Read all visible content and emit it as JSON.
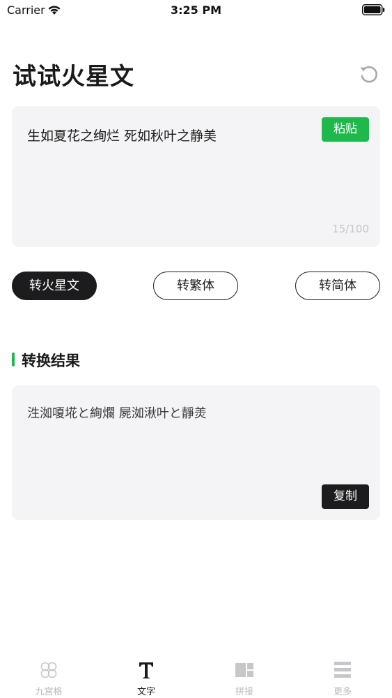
{
  "status_bar": {
    "carrier": "Carrier",
    "time": "3:25 PM"
  },
  "header": {
    "title": "试试火星文",
    "reset_icon": "refresh-icon"
  },
  "input": {
    "text": "生如夏花之绚烂 死如秋叶之静美",
    "paste_label": "粘贴",
    "char_count": "15/100"
  },
  "conversion": {
    "buttons": [
      {
        "label": "转火星文",
        "active": true
      },
      {
        "label": "转繁体",
        "active": false
      },
      {
        "label": "转简体",
        "active": false
      }
    ]
  },
  "result": {
    "title": "转换结果",
    "text": "泩洳嗄埖と絢爛 屍洳湫叶と靜羙",
    "copy_label": "复制"
  },
  "tab_bar": {
    "tabs": [
      {
        "label": "九宫格",
        "icon": "grid-icon",
        "active": false
      },
      {
        "label": "文字",
        "icon": "text-icon",
        "active": true
      },
      {
        "label": "拼接",
        "icon": "collage-icon",
        "active": false
      },
      {
        "label": "更多",
        "icon": "menu-icon",
        "active": false
      }
    ]
  },
  "colors": {
    "accent_green": "#1fb84b",
    "dark": "#1c1c1e",
    "card_bg": "#f4f4f6",
    "inactive_tab": "#b9b9bd"
  }
}
